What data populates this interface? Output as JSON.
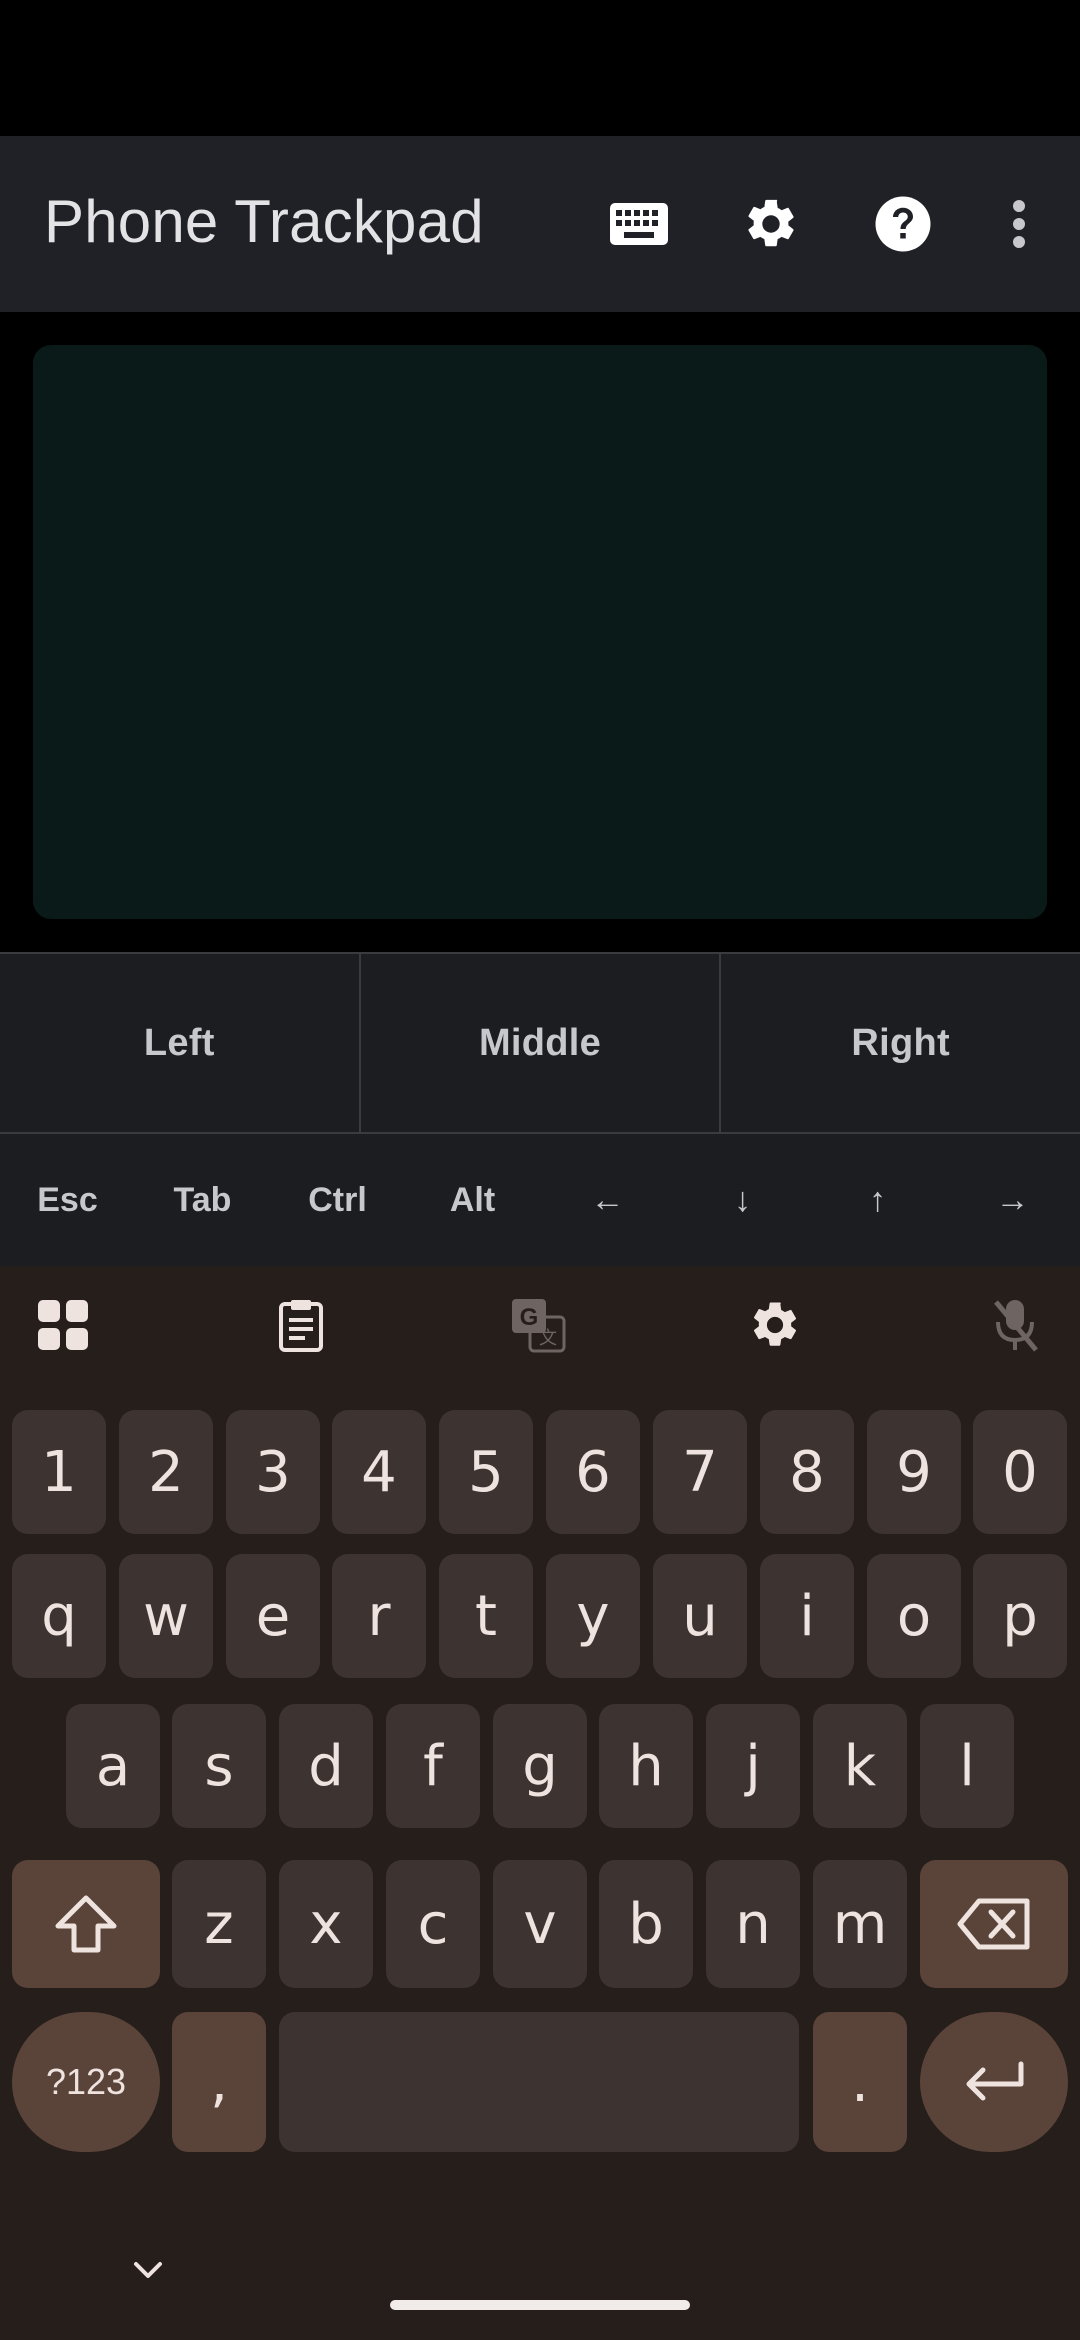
{
  "app": {
    "title": "Phone Trackpad",
    "actions": [
      {
        "name": "keyboard-icon"
      },
      {
        "name": "settings-icon"
      },
      {
        "name": "help-icon"
      },
      {
        "name": "more-vert-icon"
      }
    ]
  },
  "mouse_buttons": [
    "Left",
    "Middle",
    "Right"
  ],
  "modifier_keys": [
    "Esc",
    "Tab",
    "Ctrl",
    "Alt",
    "←",
    "↓",
    "↑",
    "→"
  ],
  "keyboard": {
    "toolbar_icons": [
      "apps-grid-icon",
      "clipboard-icon",
      "translate-icon",
      "keyboard-settings-icon",
      "mic-off-icon"
    ],
    "rows": {
      "numbers": [
        "1",
        "2",
        "3",
        "4",
        "5",
        "6",
        "7",
        "8",
        "9",
        "0"
      ],
      "row1": [
        "q",
        "w",
        "e",
        "r",
        "t",
        "y",
        "u",
        "i",
        "o",
        "p"
      ],
      "row2": [
        "a",
        "s",
        "d",
        "f",
        "g",
        "h",
        "j",
        "k",
        "l"
      ],
      "row3": [
        "z",
        "x",
        "c",
        "v",
        "b",
        "n",
        "m"
      ]
    },
    "symbols_label": "?123",
    "comma": ",",
    "period": ".",
    "colors": {
      "key": "#3d3431",
      "function_key": "#5a4439",
      "background": "#261e1b"
    }
  }
}
